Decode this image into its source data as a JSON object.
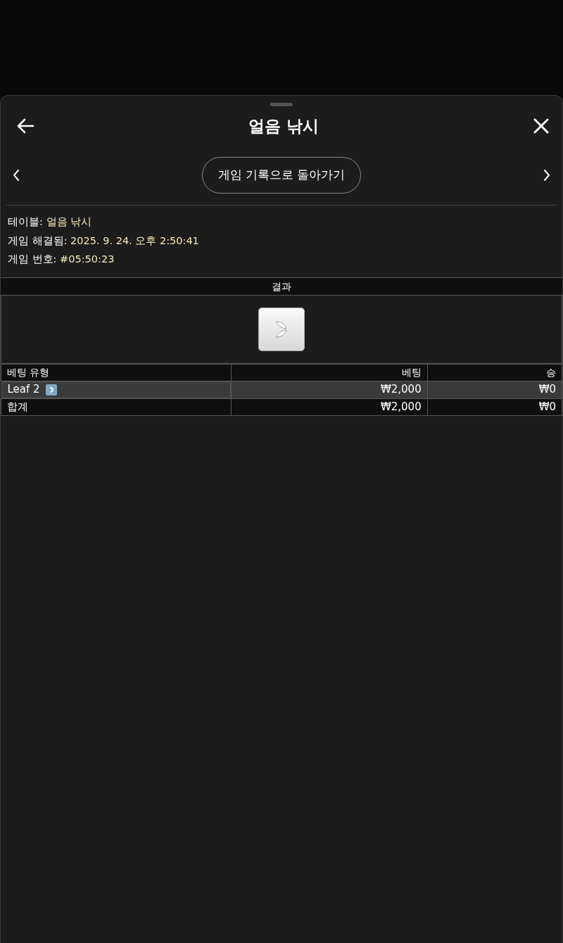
{
  "header": {
    "title": "얼음 낚시"
  },
  "nav": {
    "button": "게임 기록으로 돌아가기"
  },
  "info": [
    {
      "label": "테이블:",
      "value": "얼음 낚시"
    },
    {
      "label": "게임 해결됨:",
      "value": "2025. 9. 24. 오후 2:50:41"
    },
    {
      "label": "게임 번호:",
      "value": "#05:50:23"
    }
  ],
  "result": {
    "heading": "결과"
  },
  "bets": {
    "columns": [
      "베팅 유형",
      "베팅",
      "승"
    ],
    "rows": [
      {
        "kind": "bet",
        "cells": [
          "Leaf 2",
          "₩2,000",
          "₩0"
        ]
      },
      {
        "kind": "total",
        "cells": [
          "합계",
          "₩2,000",
          "₩0"
        ]
      }
    ]
  }
}
